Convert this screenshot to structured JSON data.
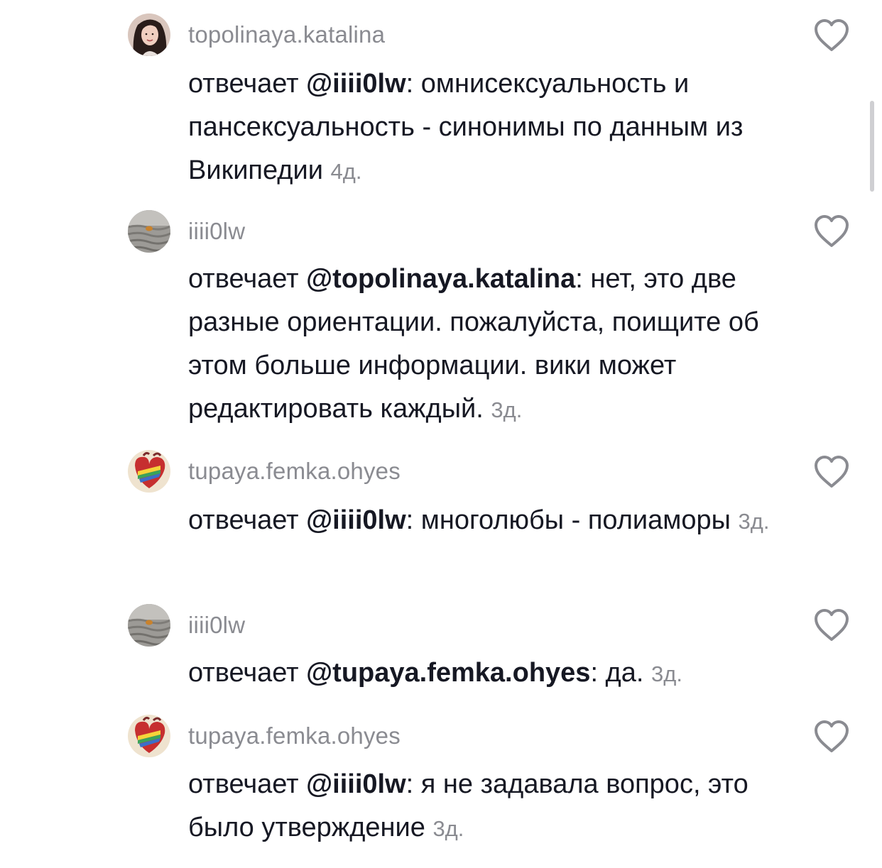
{
  "comments": [
    {
      "username": "topolinaya.katalina",
      "prefix": "отвечает ",
      "mention": "@iiii0lw",
      "body": ": омнисексуальность и пансексуальность - синонимы по данным из Википедии",
      "time": "4д.",
      "avatar_icon": "user-avatar-woman-icon",
      "like_icon": "heart-outline-icon"
    },
    {
      "username": "iiii0lw",
      "prefix": "отвечает ",
      "mention": "@topolinaya.katalina",
      "body": ": нет, это две разные ориентации. пожалуйста, поищите об этом больше информации. вики может редактировать каждый.",
      "time": "3д.",
      "avatar_icon": "user-avatar-landscape-icon",
      "like_icon": "heart-outline-icon"
    },
    {
      "username": "tupaya.femka.ohyes",
      "prefix": "отвечает ",
      "mention": "@iiii0lw",
      "body": ": многолюбы - полиаморы",
      "time": "3д.",
      "avatar_icon": "user-avatar-heart-icon",
      "like_icon": "heart-outline-icon"
    },
    {
      "username": "iiii0lw",
      "prefix": "отвечает ",
      "mention": "@tupaya.femka.ohyes",
      "body": ": да.",
      "time": "3д.",
      "avatar_icon": "user-avatar-landscape-icon",
      "like_icon": "heart-outline-icon"
    },
    {
      "username": "tupaya.femka.ohyes",
      "prefix": "отвечает ",
      "mention": "@iiii0lw",
      "body": ": я не задавала вопрос, это было утверждение",
      "time": "3д.",
      "avatar_icon": "user-avatar-heart-icon",
      "like_icon": "heart-outline-icon"
    }
  ],
  "colors": {
    "text": "#161823",
    "secondary": "#8a8b91",
    "heart_stroke": "#8a8b91",
    "background": "#ffffff"
  }
}
